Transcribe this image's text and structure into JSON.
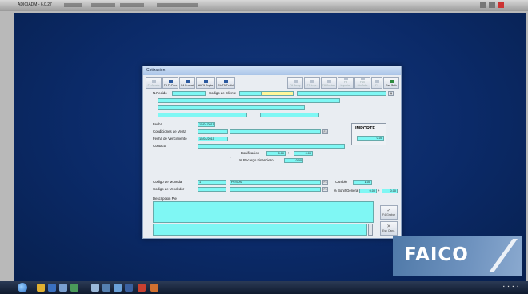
{
  "titlebar": {
    "title": "ADICIADM - 6.0.27"
  },
  "window": {
    "title": "Cotización",
    "toolbar": [
      {
        "label": "F1 Ayuda",
        "disabled": true
      },
      {
        "label": "F3 Pr.Prec",
        "disabled": false
      },
      {
        "label": "F4 Prorrat",
        "disabled": false
      },
      {
        "label": "AltF5 Copia",
        "disabled": false
      },
      {
        "label": "CtrlF5 Pedid",
        "disabled": false
      },
      {
        "label": "F6 Busq.",
        "disabled": true
      },
      {
        "label": "F7 Impr.",
        "disabled": true
      },
      {
        "label": "F8 Contab",
        "disabled": true
      },
      {
        "label": "F9 Importar",
        "disabled": true
      },
      {
        "label": "F10 Mo.Adic",
        "disabled": true
      },
      {
        "label": "F1",
        "disabled": true
      },
      {
        "label": "Esc Salir",
        "disabled": false
      }
    ],
    "form": {
      "npedido_label": "N.Pedido",
      "codigo_cliente_label": "Codigo de Cliente",
      "fecha_label": "Fecha",
      "fecha_value": "15/04/2015",
      "condiciones_label": "Condiciones de Venta",
      "vencimiento_label": "Fecha de Vencimiento",
      "vencimiento_value": "15/04/2015",
      "contacto_label": "Contacto",
      "bonificacion_label": "Bonificacion",
      "bonificacion_value": "0.00",
      "bonificacion_value2": "0.00",
      "recargo_label": "% Recargo Financiero",
      "recargo_value": "0.00",
      "importe_label": "IMPORTE",
      "importe_value": "0.00",
      "moneda_label": "Codigo de Moneda",
      "moneda_code": "1",
      "moneda_name": "PESOS",
      "vendedor_label": "Codigo de Vendedor",
      "cambio_label": "Cambio",
      "cambio_value": "1.00",
      "bonif_general_label": "% Bonif.General",
      "bonif_general_value": "0.00",
      "bonif_general_value2": "0.00",
      "descripcion_label": "Descripcion Pie",
      "f4_btn": "F4",
      "side_grabar": "F4 Grabar",
      "side_cancelar": "Esc Canc."
    }
  },
  "branding": {
    "logo_text": "FAICO"
  }
}
